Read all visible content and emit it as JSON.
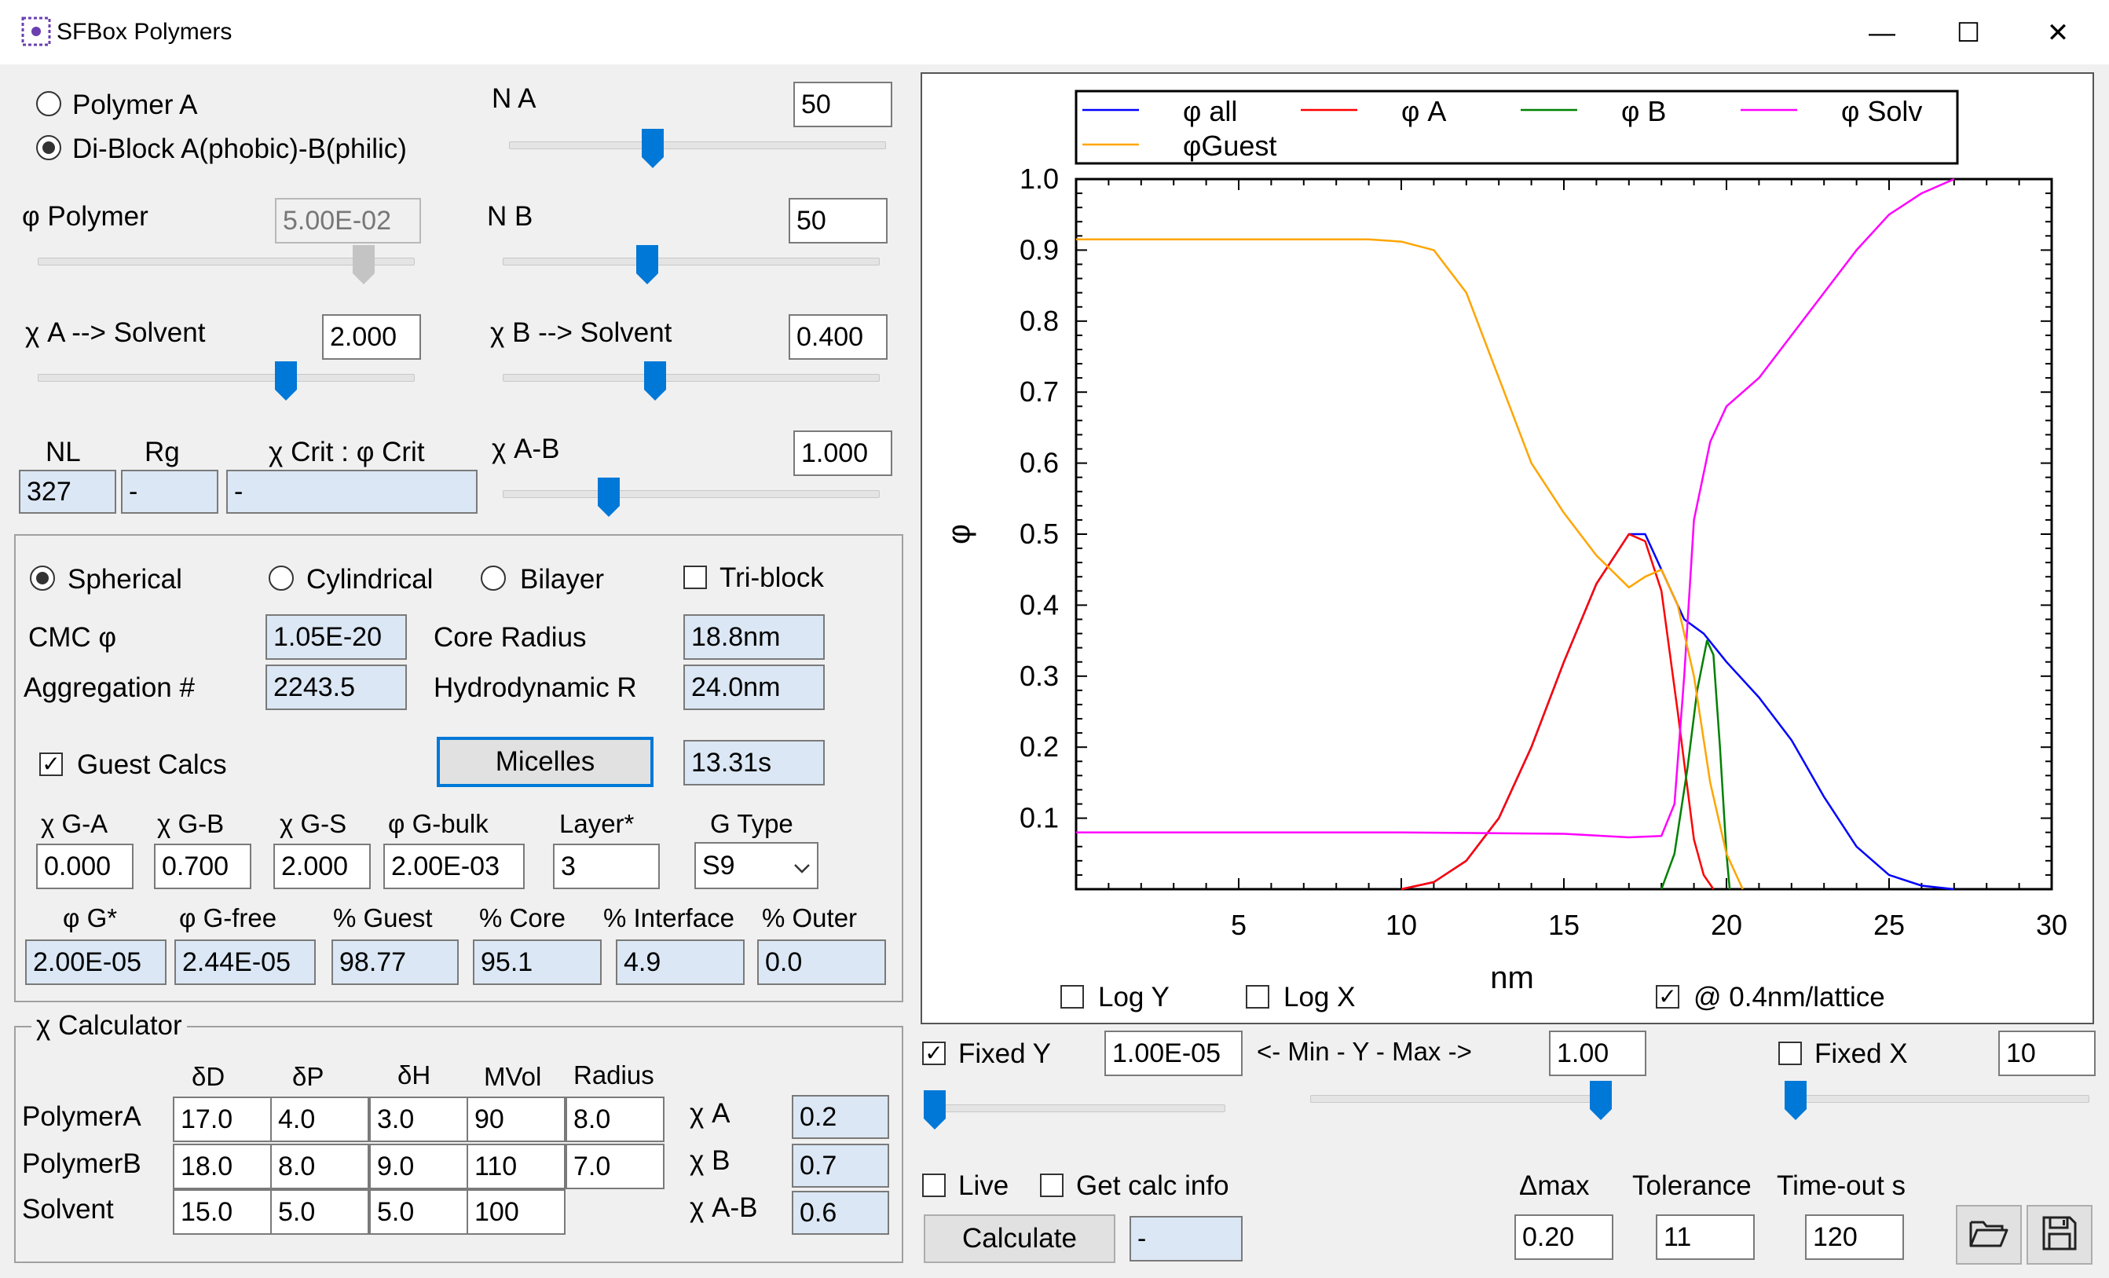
{
  "window": {
    "title": "SFBox Polymers",
    "min": "—",
    "max": "☐",
    "close": "✕"
  },
  "polymer": {
    "polymer_a": "Polymer A",
    "diblock": "Di-Block A(phobic)-B(philic)",
    "na_label": "N A",
    "na_value": "50",
    "nb_label": "N B",
    "nb_value": "50",
    "phi_polymer_label": "φ Polymer",
    "phi_polymer_value": "5.00E-02",
    "chi_a_label": "χ A --> Solvent",
    "chi_a_value": "2.000",
    "chi_b_label": "χ B --> Solvent",
    "chi_b_value": "0.400",
    "chi_ab_label": "χ A-B",
    "chi_ab_value": "1.000",
    "nl_label": "NL",
    "nl_value": "327",
    "rg_label": "Rg",
    "rg_value": "-",
    "crit_label": "χ Crit : φ Crit",
    "crit_value": "-"
  },
  "micelle": {
    "spherical": "Spherical",
    "cylindrical": "Cylindrical",
    "bilayer": "Bilayer",
    "triblock": "Tri-block",
    "cmc_label": "CMC φ",
    "cmc_value": "1.05E-20",
    "core_label": "Core Radius",
    "core_value": "18.8nm",
    "agg_label": "Aggregation #",
    "agg_value": "2243.5",
    "hydro_label": "Hydrodynamic R",
    "hydro_value": "24.0nm",
    "guest_label": "Guest Calcs",
    "micelles_button": "Micelles",
    "time_value": "13.31s",
    "guest_headers": [
      "χ G-A",
      "χ G-B",
      "χ G-S",
      "φ G-bulk",
      "Layer*",
      "G Type"
    ],
    "guest_values": [
      "0.000",
      "0.700",
      "2.000",
      "2.00E-03",
      "3",
      "S9"
    ],
    "result_headers": [
      "φ G*",
      "φ G-free",
      "% Guest",
      "% Core",
      "% Interface",
      "% Outer"
    ],
    "result_values": [
      "2.00E-05",
      "2.44E-05",
      "98.77",
      "95.1",
      "4.9",
      "0.0"
    ]
  },
  "calculator": {
    "title": "χ Calculator",
    "headers": [
      "δD",
      "δP",
      "δH",
      "MVol",
      "Radius"
    ],
    "rows": [
      {
        "name": "PolymerA",
        "values": [
          "17.0",
          "4.0",
          "3.0",
          "90",
          "8.0"
        ],
        "chi_label": "χ A",
        "chi_value": "0.2"
      },
      {
        "name": "PolymerB",
        "values": [
          "18.0",
          "8.0",
          "9.0",
          "110",
          "7.0"
        ],
        "chi_label": "χ B",
        "chi_value": "0.7"
      },
      {
        "name": "Solvent",
        "values": [
          "15.0",
          "5.0",
          "5.0",
          "100",
          ""
        ],
        "chi_label": "χ A-B",
        "chi_value": "0.6"
      }
    ]
  },
  "plot_options": {
    "log_y": "Log Y",
    "log_x": "Log X",
    "lattice": "@ 0.4nm/lattice",
    "fixed_y": "Fixed Y",
    "y_min": "1.00E-05",
    "minmax_label": "<- Min - Y - Max ->",
    "y_max": "1.00",
    "fixed_x": "Fixed X",
    "x_value": "10"
  },
  "run": {
    "live": "Live",
    "calc_info": "Get calc info",
    "calculate": "Calculate",
    "status": "-",
    "dmax_label": "Δmax",
    "dmax_value": "0.20",
    "tol_label": "Tolerance",
    "tol_value": "11",
    "timeout_label": "Time-out s",
    "timeout_value": "120"
  },
  "chart_data": {
    "type": "line",
    "xlabel": "nm",
    "ylabel": "φ",
    "xlim": [
      0,
      30
    ],
    "ylim": [
      0,
      1.0
    ],
    "x_ticks": [
      5,
      10,
      15,
      20,
      25,
      30
    ],
    "y_ticks": [
      0.1,
      0.2,
      0.3,
      0.4,
      0.5,
      0.6,
      0.7,
      0.8,
      0.9,
      1.0
    ],
    "legend_position": "top",
    "series": [
      {
        "name": "φ all",
        "color": "#0000ff",
        "points": [
          [
            10,
            0
          ],
          [
            11,
            0.01
          ],
          [
            12,
            0.04
          ],
          [
            13,
            0.1
          ],
          [
            14,
            0.2
          ],
          [
            15,
            0.32
          ],
          [
            16,
            0.43
          ],
          [
            17,
            0.5
          ],
          [
            17.5,
            0.5
          ],
          [
            18,
            0.45
          ],
          [
            18.7,
            0.38
          ],
          [
            19.3,
            0.36
          ],
          [
            20,
            0.32
          ],
          [
            21,
            0.27
          ],
          [
            22,
            0.21
          ],
          [
            23,
            0.13
          ],
          [
            24,
            0.06
          ],
          [
            25,
            0.02
          ],
          [
            26,
            0.005
          ],
          [
            27,
            0
          ]
        ]
      },
      {
        "name": "φ A",
        "color": "#ff0000",
        "points": [
          [
            10,
            0
          ],
          [
            11,
            0.01
          ],
          [
            12,
            0.04
          ],
          [
            13,
            0.1
          ],
          [
            14,
            0.2
          ],
          [
            15,
            0.32
          ],
          [
            16,
            0.43
          ],
          [
            17,
            0.5
          ],
          [
            17.5,
            0.49
          ],
          [
            18,
            0.42
          ],
          [
            18.5,
            0.25
          ],
          [
            19,
            0.07
          ],
          [
            19.3,
            0.02
          ],
          [
            19.6,
            0
          ]
        ]
      },
      {
        "name": "φ B",
        "color": "#008000",
        "points": [
          [
            18,
            0
          ],
          [
            18.4,
            0.05
          ],
          [
            18.8,
            0.17
          ],
          [
            19.1,
            0.28
          ],
          [
            19.4,
            0.35
          ],
          [
            19.6,
            0.33
          ],
          [
            19.8,
            0.2
          ],
          [
            20,
            0.05
          ],
          [
            20.1,
            0
          ]
        ]
      },
      {
        "name": "φ Solv",
        "color": "#ff00ff",
        "points": [
          [
            0,
            0.08
          ],
          [
            5,
            0.08
          ],
          [
            10,
            0.08
          ],
          [
            15,
            0.078
          ],
          [
            17,
            0.073
          ],
          [
            18,
            0.075
          ],
          [
            18.4,
            0.12
          ],
          [
            18.7,
            0.3
          ],
          [
            19,
            0.52
          ],
          [
            19.5,
            0.63
          ],
          [
            20,
            0.68
          ],
          [
            21,
            0.72
          ],
          [
            22,
            0.78
          ],
          [
            23,
            0.84
          ],
          [
            24,
            0.9
          ],
          [
            25,
            0.95
          ],
          [
            26,
            0.98
          ],
          [
            27,
            1.0
          ]
        ]
      },
      {
        "name": "φGuest",
        "color": "#ffa500",
        "points": [
          [
            0,
            0.915
          ],
          [
            5,
            0.915
          ],
          [
            9,
            0.915
          ],
          [
            10,
            0.912
          ],
          [
            11,
            0.9
          ],
          [
            12,
            0.84
          ],
          [
            13,
            0.72
          ],
          [
            14,
            0.6
          ],
          [
            15,
            0.53
          ],
          [
            16,
            0.47
          ],
          [
            17,
            0.425
          ],
          [
            17.5,
            0.44
          ],
          [
            18,
            0.45
          ],
          [
            18.5,
            0.4
          ],
          [
            19,
            0.3
          ],
          [
            19.5,
            0.15
          ],
          [
            20,
            0.05
          ],
          [
            20.5,
            0
          ]
        ]
      }
    ]
  }
}
